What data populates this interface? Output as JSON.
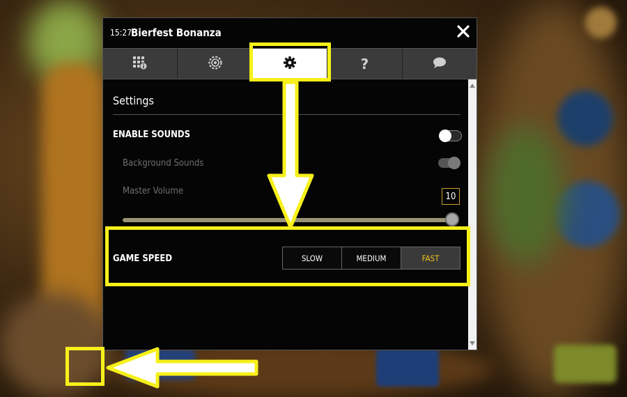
{
  "window": {
    "time": "15:27",
    "title": "Bierfest Bonanza"
  },
  "tabs": [
    {
      "icon": "paytable-icon",
      "active": false
    },
    {
      "icon": "chip-icon",
      "active": false
    },
    {
      "icon": "gear-icon",
      "active": true
    },
    {
      "icon": "help-icon",
      "label": "?",
      "active": false
    },
    {
      "icon": "chat-icon",
      "active": false
    }
  ],
  "settings": {
    "heading": "Settings",
    "enable_sounds": {
      "label": "ENABLE SOUNDS",
      "state": "off"
    },
    "background_sounds": {
      "label": "Background Sounds",
      "state": "on"
    },
    "master_volume": {
      "label": "Master Volume",
      "value": "10"
    },
    "game_speed": {
      "label": "GAME SPEED",
      "options": [
        "SLOW",
        "MEDIUM",
        "FAST"
      ],
      "selected": "FAST"
    }
  },
  "colors": {
    "annotation": "#f7f01a",
    "selected_speed_text": "#f0c21b",
    "volume_border": "#c8a12a"
  }
}
